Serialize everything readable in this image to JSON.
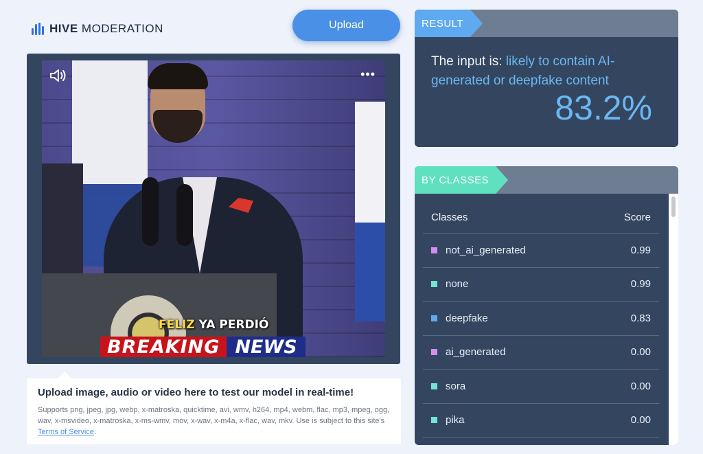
{
  "header": {
    "brand_bold": "HIVE",
    "brand_light": "MODERATION",
    "upload_label": "Upload"
  },
  "media": {
    "caption_yellow": "FELIZ",
    "caption_white": "YA PERDIÓ",
    "banner_left": "BREAKING",
    "banner_right": "NEWS",
    "sound_icon": "speaker-icon",
    "more_icon": "more-horizontal-icon"
  },
  "info": {
    "title": "Upload image, audio or video here to test our model in real-time!",
    "supports": "Supports png, jpeg, jpg, webp, x-matroska, quicktime, avi, wmv, h264, mp4, webm, flac, mp3, mpeg, ogg, wav, x-msvideo, x-matroska, x-ms-wmv, mov, x-wav, x-m4a, x-flac, wav, mkv. Use is subject to this site's ",
    "terms_link": "Terms of Service",
    "terms_end": "."
  },
  "result": {
    "tag": "RESULT",
    "prefix": "The input is: ",
    "verdict": "likely to contain AI-generated or deepfake content",
    "score": "83.2%",
    "accent": "#6ab7f2"
  },
  "classes": {
    "tag": "BY CLASSES",
    "col_class": "Classes",
    "col_score": "Score",
    "rows": [
      {
        "name": "not_ai_generated",
        "score": "0.99",
        "color": "#d58bf0"
      },
      {
        "name": "none",
        "score": "0.99",
        "color": "#6fe6d2"
      },
      {
        "name": "deepfake",
        "score": "0.83",
        "color": "#5ea9ef"
      },
      {
        "name": "ai_generated",
        "score": "0.00",
        "color": "#d58bf0"
      },
      {
        "name": "sora",
        "score": "0.00",
        "color": "#6fe6d2"
      },
      {
        "name": "pika",
        "score": "0.00",
        "color": "#6fe6d2"
      }
    ]
  }
}
